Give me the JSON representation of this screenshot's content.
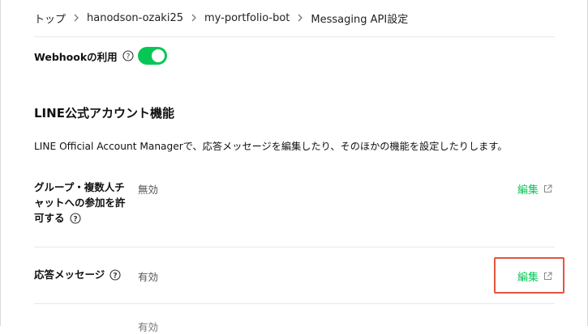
{
  "breadcrumb": {
    "items": [
      "トップ",
      "hanodson-ozaki25",
      "my-portfolio-bot",
      "Messaging API設定"
    ]
  },
  "webhook": {
    "label": "Webhookの利用",
    "enabled": true
  },
  "line_oa": {
    "title": "LINE公式アカウント機能",
    "description": "LINE Official Account Managerで、応答メッセージを編集したり、そのほかの機能を設定したりします。",
    "rows": [
      {
        "label_lines": [
          "グループ・複数人チ",
          "ャットへの参加を許",
          "可する"
        ],
        "value": "無効",
        "edit_label": "編集"
      },
      {
        "label_lines": [
          "応答メッセージ"
        ],
        "value": "有効",
        "edit_label": "編集"
      }
    ],
    "partial_value": "有効"
  },
  "colors": {
    "accent": "#06c755",
    "highlight": "#e5533d"
  }
}
